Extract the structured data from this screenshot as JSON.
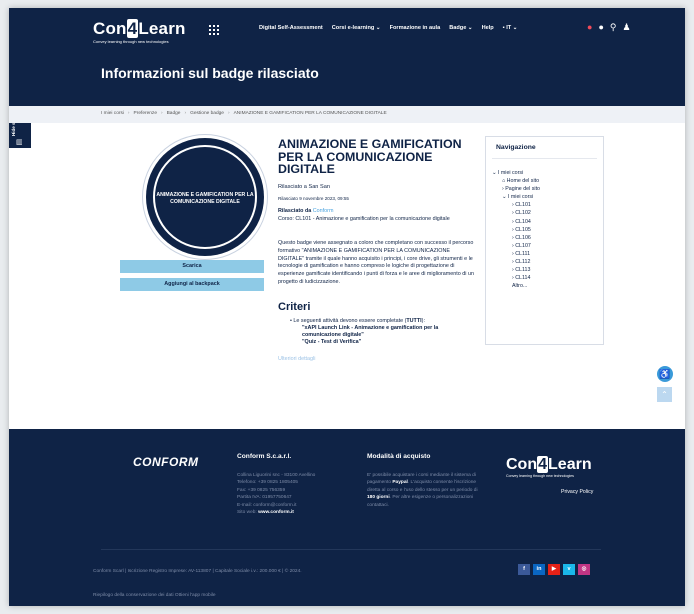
{
  "header": {
    "logo": {
      "prefix": "Con",
      "four": "4",
      "suffix": "Learn",
      "tagline": "Convey learning through new technologies"
    },
    "nav": [
      "Digital Self-Assessment",
      "Corsi e-learning ⌄",
      "Formazione in aula",
      "Badge ⌄",
      "Help",
      "▪ IT ⌄"
    ],
    "icons": [
      "bell-icon",
      "chat-icon",
      "search-icon",
      "user-icon"
    ],
    "page_title": "Informazioni sul badge rilasciato"
  },
  "side_tab": {
    "label": "Hide sidebars",
    "icon": "sidebar-icon"
  },
  "breadcrumb": [
    "I miei corsi",
    "Preferenze",
    "Badge",
    "Gestione badge",
    "ANIMAZIONE E GAMIFICATION PER LA COMUNICAZIONE DIGITALE"
  ],
  "badge": {
    "image_text": "ANIMAZIONE E GAMIFICATION PER LA COMUNICAZIONE DIGITALE",
    "download_label": "Scarica",
    "backpack_label": "Aggiungi al backpack"
  },
  "detail": {
    "title": "ANIMAZIONE E GAMIFICATION PER LA COMUNICAZIONE DIGITALE",
    "issued_to": "Rilasciato a San San",
    "issued_date": "Rilasciato 9 novembre 2023, 09:55",
    "issuer_label": "Rilasciato da",
    "issuer": "Conform",
    "course": "Corso: CL101 - Animazione e gamification per la comunicazione digitale",
    "description": "Questo badge viene assegnato a coloro che completano con successo il percorso formativo \"ANIMAZIONE E GAMIFICATION PER LA COMUNICAZIONE DIGITALE\" tramite il quale hanno acquisito i principi, i core drive, gli strumenti e le tecnologie di gamification e hanno compreso le logiche di progettazione di esperienze gamificate identificando i punti di forza e le aree di miglioramento di un progetto di ludicizzazione.",
    "criteria_heading": "Criteri",
    "criteria_intro": "Le seguenti attività devono essere completate (",
    "criteria_all": "TUTTI",
    "criteria_end": "):",
    "criteria_items": [
      "\"xAPI Launch Link - Animazione e gamification per la comunicazione digitale\"",
      "\"Quiz - Test di Verifica\""
    ],
    "more_label": "Ulteriori dettagli"
  },
  "navigation": {
    "heading": "Navigazione",
    "items": [
      {
        "label": "⌄ I miei corsi",
        "indent": 0
      },
      {
        "label": "⌂ Home del sito",
        "indent": 1
      },
      {
        "label": "› Pagine del sito",
        "indent": 1
      },
      {
        "label": "⌄ I miei corsi",
        "indent": 1
      },
      {
        "label": "› CL101",
        "indent": 2
      },
      {
        "label": "› CL102",
        "indent": 2
      },
      {
        "label": "› CL104",
        "indent": 2
      },
      {
        "label": "› CL105",
        "indent": 2
      },
      {
        "label": "› CL106",
        "indent": 2
      },
      {
        "label": "› CL107",
        "indent": 2
      },
      {
        "label": "› CL111",
        "indent": 2
      },
      {
        "label": "› CL112",
        "indent": 2
      },
      {
        "label": "› CL113",
        "indent": 2
      },
      {
        "label": "› CL114",
        "indent": 2
      },
      {
        "label": "Altro...",
        "indent": 2
      }
    ]
  },
  "footer": {
    "conform_logo": "CONFORM",
    "company": {
      "heading": "Conform S.c.a.r.l.",
      "lines": [
        "Collina Liguorini snc - 83100 Avellino",
        "Telefono: +39 0825 1805405",
        "Fax: +39 0825 756359",
        "Partita IVA: 01957750647",
        "E-mail: conform@conform.it"
      ],
      "site_label": "Sito web:",
      "site": "www.conform.it"
    },
    "purchase": {
      "heading": "Modalità di acquisto",
      "text1": "E' possibile acquistare i corsi mediante il sistema di pagamento",
      "paypal": "Paypal",
      "text2": ". L'acquisto consente l'iscrizione diretta al corso e l'uso dello stesso per un periodo di",
      "days": "180 giorni",
      "text3": ". Per altre esigenze o personalizzazioni contattaci."
    },
    "privacy": "Privacy Policy",
    "legal": "Conform Scarl | Iscrizione Registro Imprese: AV-113807 | Capitale Sociale i.v.: 200.000 € | © 2024.",
    "social": [
      {
        "label": "f",
        "color": "#3b5998",
        "icon": "facebook-icon"
      },
      {
        "label": "in",
        "color": "#0a66c2",
        "icon": "linkedin-icon"
      },
      {
        "label": "▶",
        "color": "#e62117",
        "icon": "youtube-icon"
      },
      {
        "label": "v",
        "color": "#1ab7ea",
        "icon": "vimeo-icon"
      },
      {
        "label": "◎",
        "color": "#c13584",
        "icon": "instagram-icon"
      }
    ],
    "bottom": "Riepilogo della conservazione dei dati   Ottieni l'app mobile"
  },
  "colors": {
    "navy": "#0f2346",
    "button": "#8ecae6",
    "link": "#4aa3df"
  }
}
